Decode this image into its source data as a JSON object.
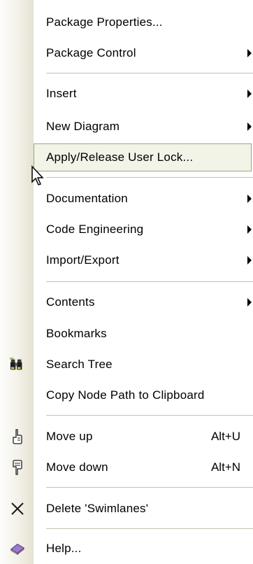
{
  "menu": {
    "items": [
      {
        "id": "package-properties",
        "label": "Package Properties..."
      },
      {
        "id": "package-control",
        "label": "Package Control"
      },
      {
        "id": "insert",
        "label": "Insert"
      },
      {
        "id": "new-diagram",
        "label": "New Diagram"
      },
      {
        "id": "apply-release-user-lock",
        "label": "Apply/Release User Lock..."
      },
      {
        "id": "documentation",
        "label": "Documentation"
      },
      {
        "id": "code-engineering",
        "label": "Code Engineering"
      },
      {
        "id": "import-export",
        "label": "Import/Export"
      },
      {
        "id": "contents",
        "label": "Contents"
      },
      {
        "id": "bookmarks",
        "label": "Bookmarks"
      },
      {
        "id": "search-tree",
        "label": "Search Tree"
      },
      {
        "id": "copy-node-path",
        "label": "Copy Node Path to Clipboard"
      },
      {
        "id": "move-up",
        "label": "Move up",
        "shortcut": "Alt+U"
      },
      {
        "id": "move-down",
        "label": "Move down",
        "shortcut": "Alt+N"
      },
      {
        "id": "delete",
        "label": "Delete 'Swimlanes'"
      },
      {
        "id": "help",
        "label": "Help..."
      }
    ]
  },
  "icons": {
    "search_tree": "binoculars-icon",
    "move_up": "hand-pointing-up-icon",
    "move_down": "hand-pointing-down-icon",
    "delete": "delete-x-icon",
    "help": "help-book-icon"
  },
  "colors": {
    "highlight_bg": "#f1f4e6",
    "highlight_border": "#97a780",
    "separator": "#c5c2b2"
  }
}
